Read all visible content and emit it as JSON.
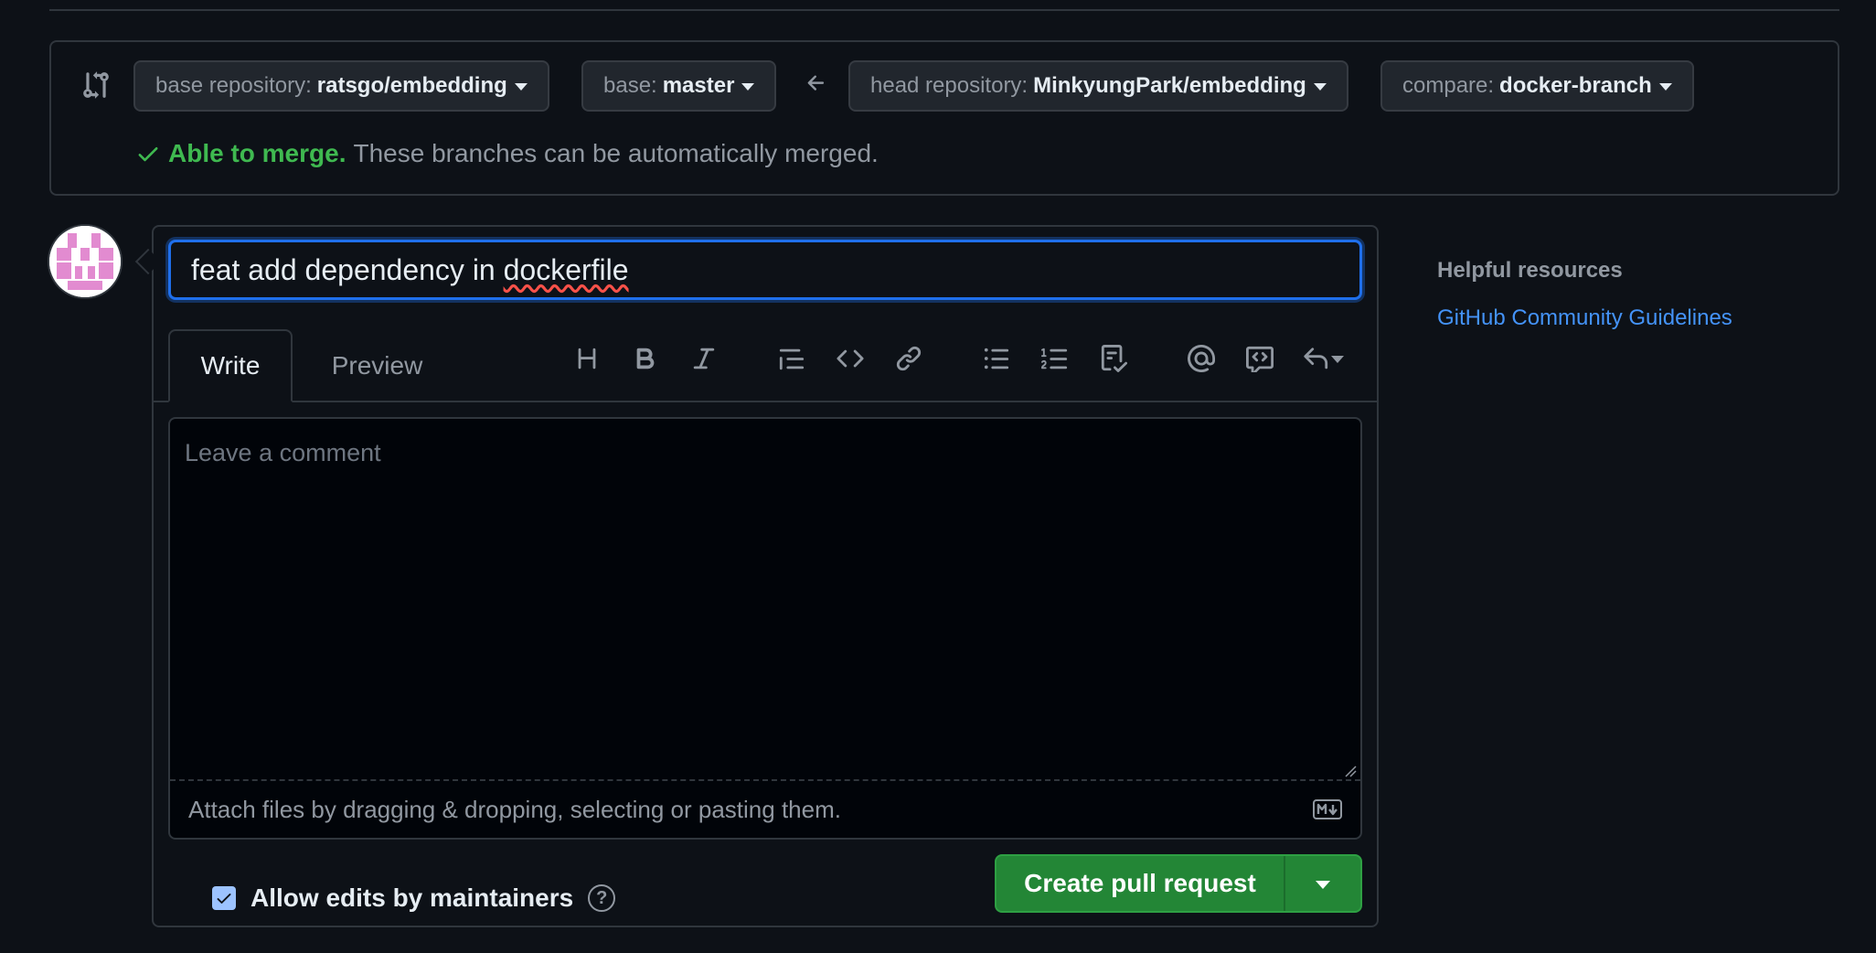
{
  "compare": {
    "base_repo_key": "base repository:",
    "base_repo_value": "ratsgo/embedding",
    "base_key": "base:",
    "base_value": "master",
    "head_repo_key": "head repository:",
    "head_repo_value": "MinkyungPark/embedding",
    "compare_key": "compare:",
    "compare_value": "docker-branch",
    "merge_ok": "Able to merge.",
    "merge_desc": "These branches can be automatically merged."
  },
  "form": {
    "title_prefix": "feat add dependency in ",
    "title_misspelled": "dockerfile",
    "tabs": [
      "Write",
      "Preview"
    ],
    "toolbar_icons": [
      "heading-icon",
      "bold-icon",
      "italic-icon",
      "quote-icon",
      "code-icon",
      "link-icon",
      "bulleted-list-icon",
      "numbered-list-icon",
      "task-list-icon",
      "mention-icon",
      "reference-icon",
      "saved-replies-icon"
    ],
    "comment_placeholder": "Leave a comment",
    "attach_text": "Attach files by dragging & dropping, selecting or pasting them.",
    "allow_edits_label": "Allow edits by maintainers",
    "allow_edits_checked": true,
    "help_glyph": "?",
    "create_button": "Create pull request"
  },
  "sidebar": {
    "heading": "Helpful resources",
    "link": "GitHub Community Guidelines"
  },
  "colors": {
    "background": "#0d1117",
    "accent_blue": "#1f6feb",
    "success_green": "#3fb950",
    "button_green": "#238636",
    "link_blue": "#4493f8"
  }
}
